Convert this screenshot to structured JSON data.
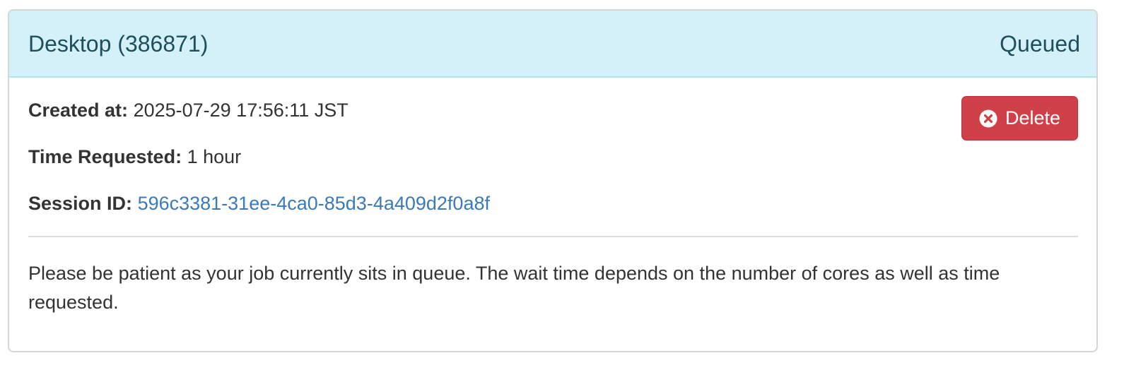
{
  "card": {
    "title": "Desktop (386871)",
    "status": "Queued",
    "header_color": "#d4f1f9",
    "status_color": "#1f4f5e"
  },
  "details": {
    "created_label": "Created at:",
    "created_value": "2025-07-29 17:56:11 JST",
    "time_label": "Time Requested:",
    "time_value": "1 hour",
    "session_label": "Session ID:",
    "session_value": "596c3381-31ee-4ca0-85d3-4a409d2f0a8f"
  },
  "actions": {
    "delete_label": "Delete",
    "delete_icon": "times-circle-icon",
    "delete_color": "#cf4048"
  },
  "notice": {
    "text": "Please be patient as your job currently sits in queue. The wait time depends on the number of cores as well as time requested."
  }
}
